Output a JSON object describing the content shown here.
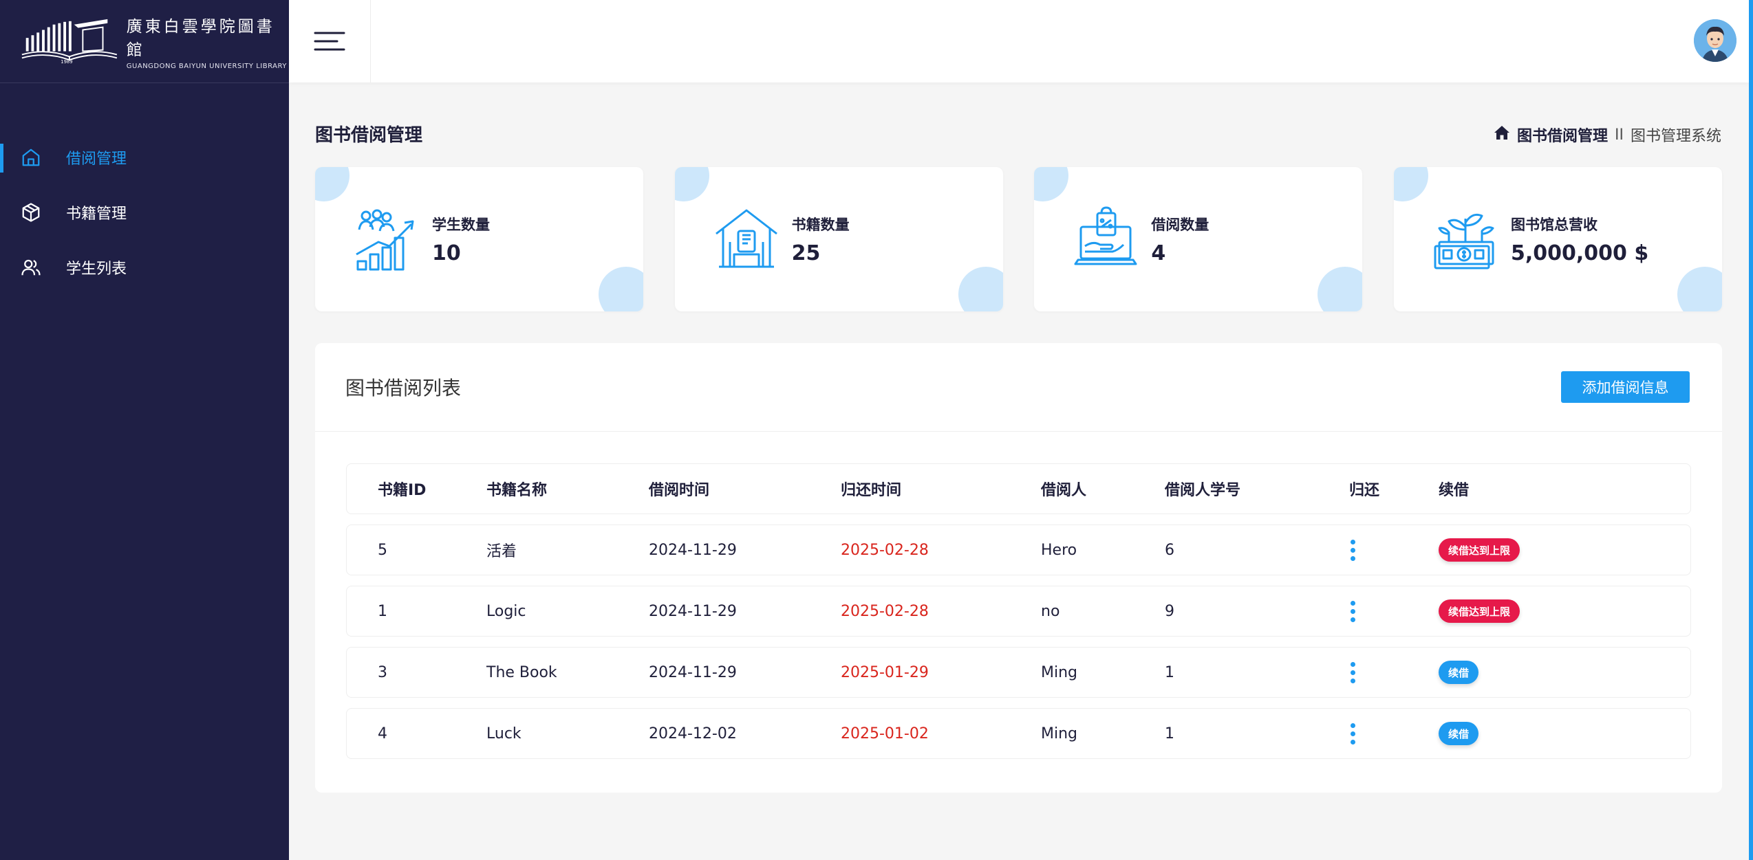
{
  "brand": {
    "name_cn": "廣東白雲學院圖書館",
    "name_en": "GUANGDONG BAIYUN UNIVERSITY LIBRARY",
    "emblem_year": "1989"
  },
  "sidebar": {
    "items": [
      {
        "label": "借阅管理",
        "icon": "home-icon",
        "active": true
      },
      {
        "label": "书籍管理",
        "icon": "box-icon",
        "active": false
      },
      {
        "label": "学生列表",
        "icon": "users-icon",
        "active": false
      }
    ]
  },
  "header": {
    "menu_icon": "hamburger-icon",
    "avatar": "user-avatar"
  },
  "page": {
    "title": "图书借阅管理",
    "breadcrumb": {
      "home_icon": "home-icon",
      "current": "图书借阅管理",
      "separator": "II",
      "root": "图书管理系统"
    }
  },
  "stats": [
    {
      "label": "学生数量",
      "value": "10",
      "icon": "students-growth-icon"
    },
    {
      "label": "书籍数量",
      "value": "25",
      "icon": "library-building-icon"
    },
    {
      "label": "借阅数量",
      "value": "4",
      "icon": "laptop-bag-icon"
    },
    {
      "label": "图书馆总营收",
      "value": "5,000,000 $",
      "icon": "money-plant-icon"
    }
  ],
  "borrow_list": {
    "title": "图书借阅列表",
    "add_button": "添加借阅信息",
    "columns": [
      "书籍ID",
      "书籍名称",
      "借阅时间",
      "归还时间",
      "借阅人",
      "借阅人学号",
      "归还",
      "续借"
    ],
    "rows": [
      {
        "id": "5",
        "name": "活着",
        "borrow_date": "2024-11-29",
        "return_date": "2025-02-28",
        "borrower": "Hero",
        "student_id": "6",
        "renew": "续借达到上限",
        "renew_status": "limit"
      },
      {
        "id": "1",
        "name": "Logic",
        "borrow_date": "2024-11-29",
        "return_date": "2025-02-28",
        "borrower": "no",
        "student_id": "9",
        "renew": "续借达到上限",
        "renew_status": "limit"
      },
      {
        "id": "3",
        "name": "The Book",
        "borrow_date": "2024-11-29",
        "return_date": "2025-01-29",
        "borrower": "Ming",
        "student_id": "1",
        "renew": "续借",
        "renew_status": "available"
      },
      {
        "id": "4",
        "name": "Luck",
        "borrow_date": "2024-12-02",
        "return_date": "2025-01-02",
        "borrower": "Ming",
        "student_id": "1",
        "renew": "续借",
        "renew_status": "available"
      }
    ]
  },
  "colors": {
    "sidebar_bg": "#1f1f45",
    "accent": "#1e9bf0",
    "danger": "#e6194a",
    "due_date": "#d9251d",
    "card_blob": "#cde7fb"
  }
}
